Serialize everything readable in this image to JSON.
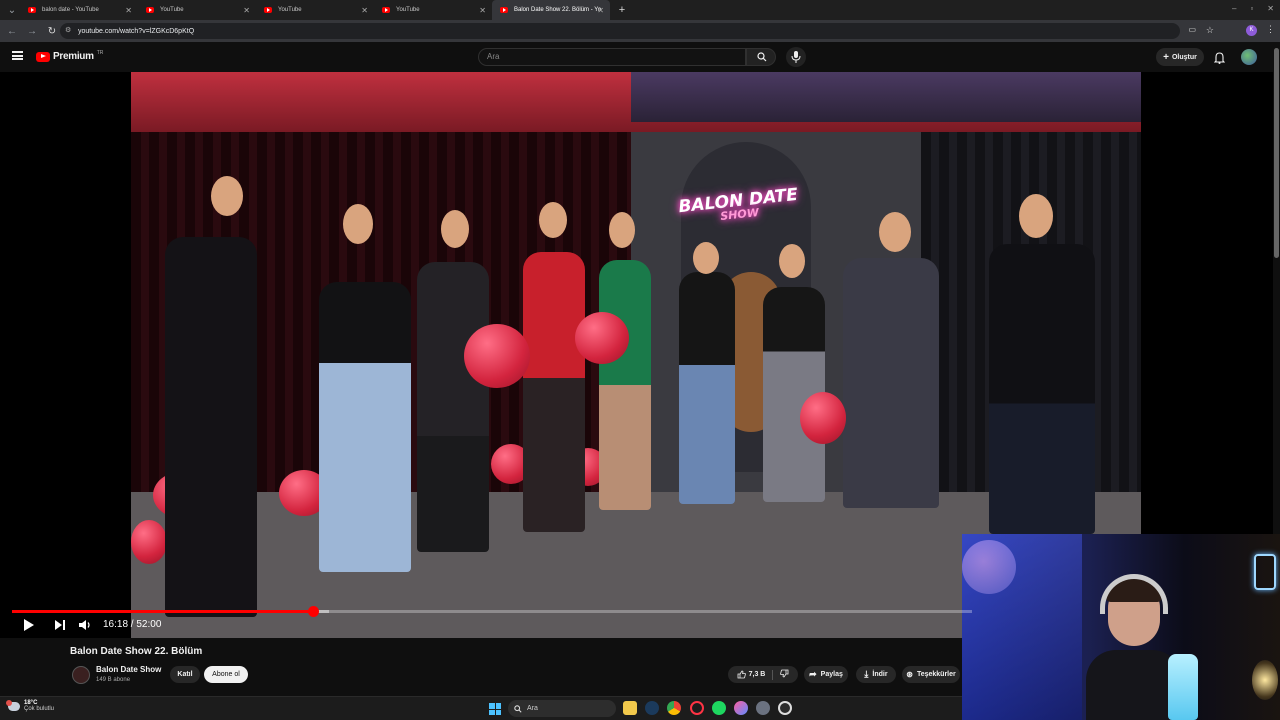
{
  "browser": {
    "tabs": [
      {
        "label": "balon date - YouTube",
        "active": false
      },
      {
        "label": "YouTube",
        "active": false
      },
      {
        "label": "YouTube",
        "active": false
      },
      {
        "label": "YouTube",
        "active": false
      },
      {
        "label": "Balon Date Show 22. Bölüm - Yo",
        "active": true
      }
    ],
    "url": "youtube.com/watch?v=lZGKcD6pKtQ"
  },
  "youtube": {
    "logo_text": "Premium",
    "logo_sup": "TR",
    "search_placeholder": "Ara",
    "create_label": "Oluştur"
  },
  "player": {
    "time_current": "16:18",
    "time_total": "52:00",
    "time_display": "16:18 / 52:00",
    "played_fraction": 0.3135,
    "buffered_fraction": 0.33,
    "neon_sign_line1": "BALON DATE",
    "neon_sign_line2": "SHOW"
  },
  "video_info": {
    "title": "Balon Date Show 22. Bölüm",
    "channel_name": "Balon Date Show",
    "subscribers": "149 B abone",
    "join_label": "Katıl",
    "subscribe_label": "Abone ol",
    "like_count": "7,3 B",
    "share_label": "Paylaş",
    "download_label": "İndir",
    "thanks_label": "Teşekkürler"
  },
  "taskbar": {
    "temperature": "18°C",
    "condition": "Çok bulutlu",
    "search_placeholder": "Ara"
  },
  "colors": {
    "youtube_red": "#ff0000",
    "background": "#0f0f0f"
  }
}
